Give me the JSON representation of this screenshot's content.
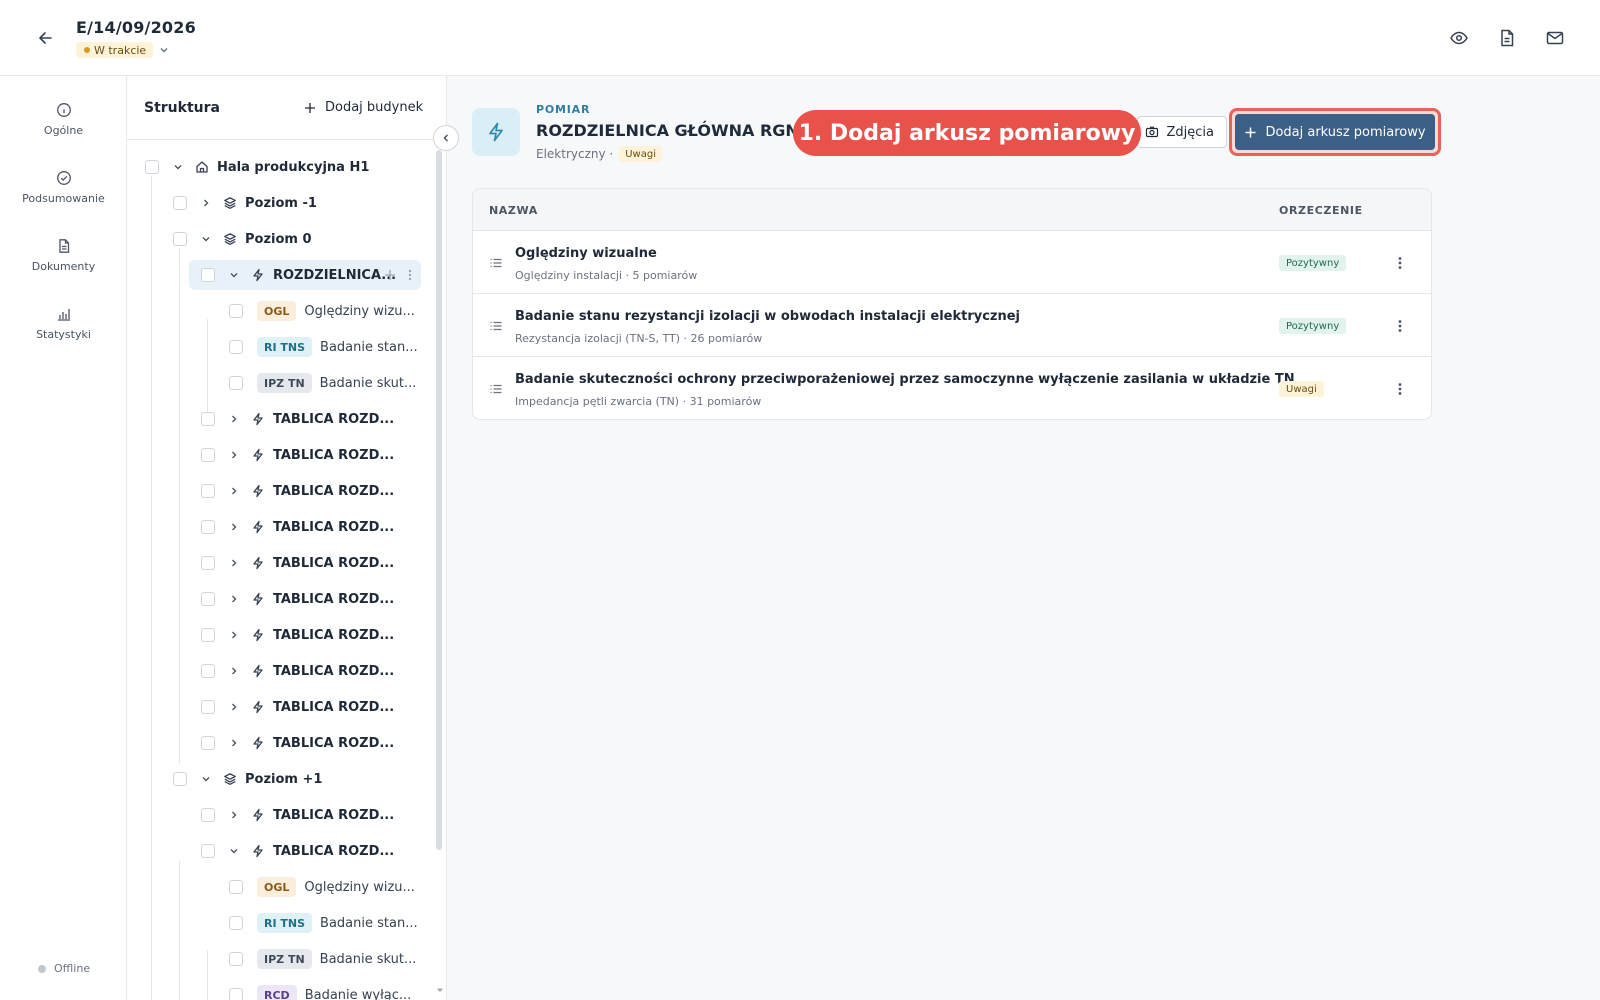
{
  "header": {
    "title": "E/14/09/2026",
    "status": "W trakcie"
  },
  "rail": {
    "items": [
      {
        "label": "Ogólne",
        "icon": "info-icon"
      },
      {
        "label": "Podsumowanie",
        "icon": "check-circle-icon"
      },
      {
        "label": "Dokumenty",
        "icon": "document-icon"
      },
      {
        "label": "Statystyki",
        "icon": "chart-icon"
      }
    ],
    "offline": "Offline"
  },
  "tree": {
    "title": "Struktura",
    "add_building": "Dodaj budynek",
    "nodes": [
      {
        "label": "Hala produkcyjna H1"
      },
      {
        "label": "Poziom -1"
      },
      {
        "label": "Poziom 0"
      },
      {
        "label": "ROZDZIELNICA..."
      },
      {
        "tag": "OGL",
        "label": "Oględziny wizu..."
      },
      {
        "tag": "RI TNS",
        "label": "Badanie stan..."
      },
      {
        "tag": "IPZ TN",
        "label": "Badanie skut..."
      },
      {
        "label": "TABLICA ROZD..."
      },
      {
        "label": "TABLICA ROZD..."
      },
      {
        "label": "TABLICA ROZD..."
      },
      {
        "label": "TABLICA ROZD..."
      },
      {
        "label": "TABLICA ROZD..."
      },
      {
        "label": "TABLICA ROZD..."
      },
      {
        "label": "TABLICA ROZD..."
      },
      {
        "label": "TABLICA ROZD..."
      },
      {
        "label": "TABLICA ROZD..."
      },
      {
        "label": "TABLICA ROZD..."
      },
      {
        "label": "Poziom +1"
      },
      {
        "label": "TABLICA ROZD..."
      },
      {
        "label": "TABLICA ROZD..."
      },
      {
        "tag": "OGL",
        "label": "Oględziny wizu..."
      },
      {
        "tag": "RI TNS",
        "label": "Badanie stan..."
      },
      {
        "tag": "IPZ TN",
        "label": "Badanie skut..."
      },
      {
        "tag": "RCD",
        "label": "Badanie wyłąc..."
      }
    ]
  },
  "main": {
    "kicker": "POMIAR",
    "title": "ROZDZIELNICA GŁÓWNA RGNN",
    "subtitle": "Elektryczny ·",
    "subtitle_badge": "Uwagi",
    "photos_button": "Zdjęcia",
    "add_button": "Dodaj arkusz pomiarowy",
    "callout": "1. Dodaj arkusz pomiarowy",
    "table": {
      "col_name": "NAZWA",
      "col_verdict": "ORZECZENIE",
      "rows": [
        {
          "name": "Oględziny wizualne",
          "meta": "Oględziny instalacji · 5 pomiarów",
          "verdict": "Pozytywny",
          "verdict_type": "positive"
        },
        {
          "name": "Badanie stanu rezystancji izolacji w obwodach instalacji elektrycznej",
          "meta": "Rezystancja izolacji (TN-S, TT) · 26 pomiarów",
          "verdict": "Pozytywny",
          "verdict_type": "positive"
        },
        {
          "name": "Badanie skuteczności ochrony przeciwporażeniowej przez samoczynne wyłączenie zasilania w układzie TN",
          "meta": "Impedancja pętli zwarcia (TN) · 31 pomiarów",
          "verdict": "Uwagi",
          "verdict_type": "warning"
        }
      ]
    }
  },
  "colors": {
    "accent": "#3b5f86",
    "callout": "#e8524a",
    "selected_row": "#e6f2f7"
  }
}
